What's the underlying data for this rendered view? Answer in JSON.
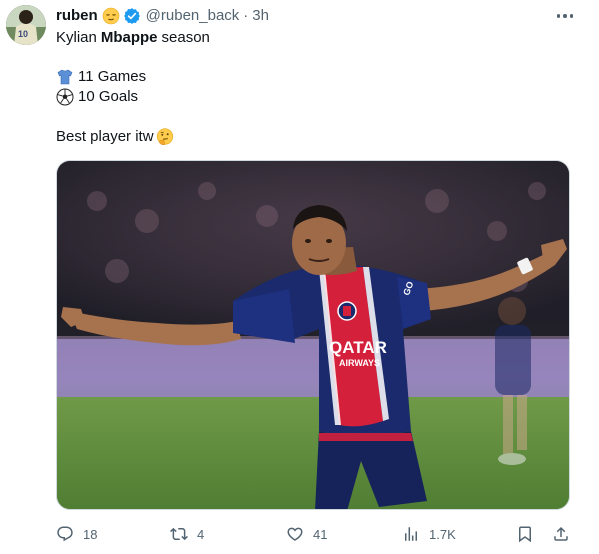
{
  "author": {
    "display_name": "ruben",
    "name_emoji": "relieved-face",
    "verified": true,
    "handle": "@ruben_back",
    "time": "3h"
  },
  "tweet": {
    "line1_pre": "Kylian",
    "line1_bold": "Mbappe",
    "line1_post": "season",
    "stat_games": "11 Games",
    "stat_games_icon": "jersey-emoji",
    "stat_goals": "10 Goals",
    "stat_goals_icon": "soccer-ball-emoji",
    "closing": "Best player itw",
    "closing_emoji": "thinking-face"
  },
  "media": {
    "jersey_sponsor_line1": "QATAR",
    "jersey_sponsor_line2": "AIRWAYS",
    "sleeve_text": "GO"
  },
  "actions": {
    "replies": "18",
    "retweets": "4",
    "likes": "41",
    "views": "1.7K"
  },
  "colors": {
    "accent_blue": "#1d9bf0",
    "muted_text": "#536471",
    "psg_navy": "#1a2a6c",
    "psg_red": "#d4203b"
  }
}
